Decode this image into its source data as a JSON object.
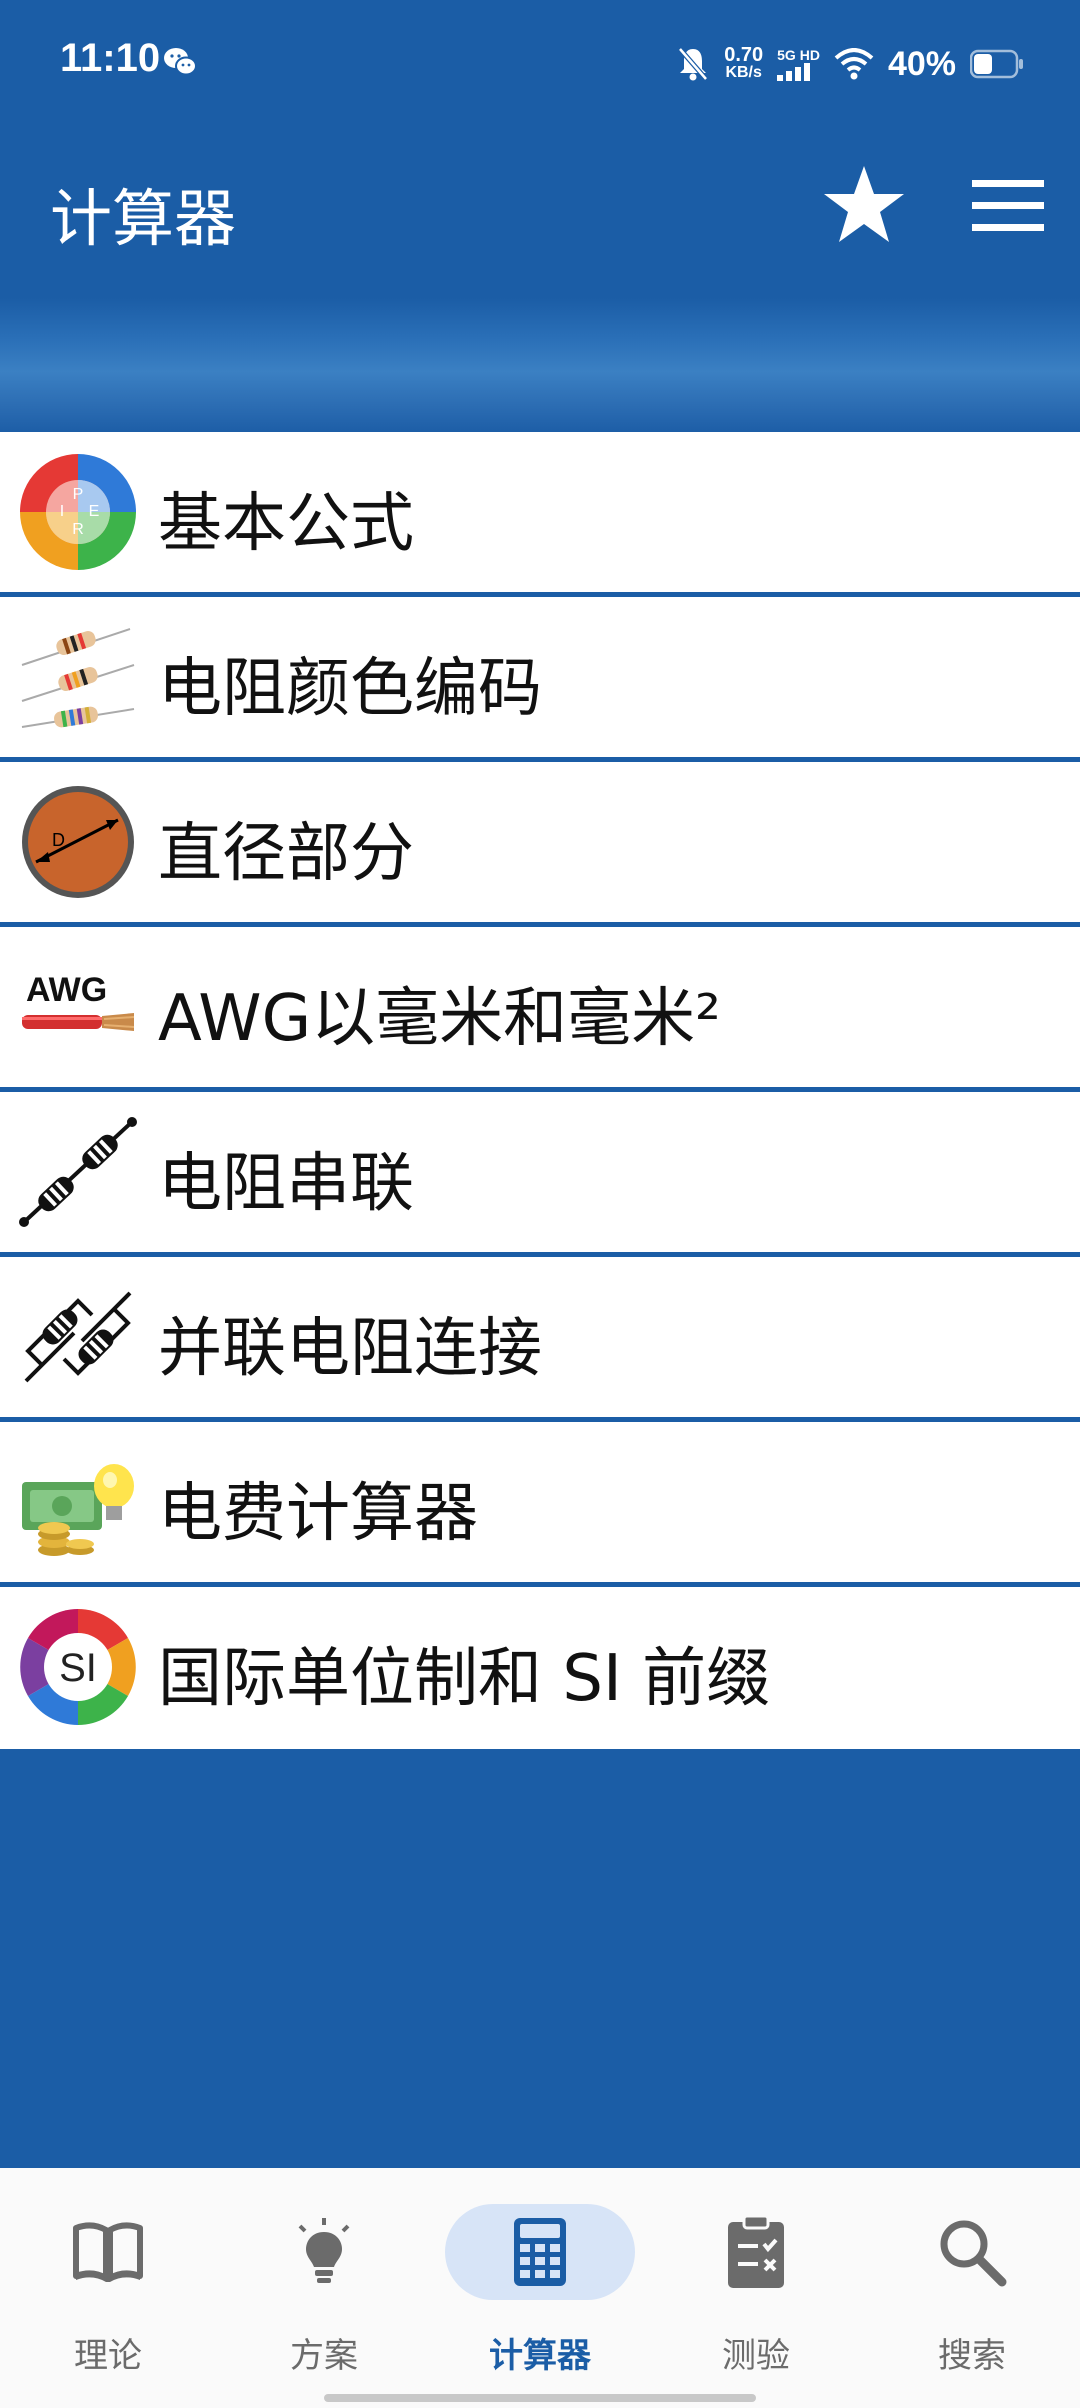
{
  "status_bar": {
    "time": "11:10",
    "net_speed_value": "0.70",
    "net_speed_unit": "KB/s",
    "network_type_top": "5G HD",
    "battery": "40%",
    "icons": [
      "wechat-icon",
      "mute-bell-icon",
      "signal-icon",
      "wifi-icon",
      "battery-icon"
    ]
  },
  "app_bar": {
    "title": "计算器",
    "icons": [
      "star-icon",
      "menu-icon"
    ]
  },
  "list": {
    "items": [
      {
        "label": "基本公式",
        "icon": "ohms-law-wheel-icon"
      },
      {
        "label": "电阻颜色编码",
        "icon": "resistor-color-code-icon"
      },
      {
        "label": "直径部分",
        "icon": "diameter-icon"
      },
      {
        "label": "AWG以毫米和毫米²",
        "icon": "awg-wire-icon"
      },
      {
        "label": "电阻串联",
        "icon": "resistors-series-icon"
      },
      {
        "label": "并联电阻连接",
        "icon": "resistors-parallel-icon"
      },
      {
        "label": "电费计算器",
        "icon": "electricity-cost-icon"
      },
      {
        "label": "国际单位制和 SI 前缀",
        "icon": "si-units-icon"
      }
    ]
  },
  "bottom_nav": {
    "items": [
      {
        "label": "理论",
        "icon": "book-icon",
        "active": false
      },
      {
        "label": "方案",
        "icon": "lightbulb-icon",
        "active": false
      },
      {
        "label": "计算器",
        "icon": "calculator-icon",
        "active": true
      },
      {
        "label": "测验",
        "icon": "clipboard-icon",
        "active": false
      },
      {
        "label": "搜索",
        "icon": "search-icon",
        "active": false
      }
    ]
  },
  "colors": {
    "primary": "#1b5da6",
    "active_pill": "#d7e4f7",
    "nav_inactive": "#6b6b6b"
  }
}
